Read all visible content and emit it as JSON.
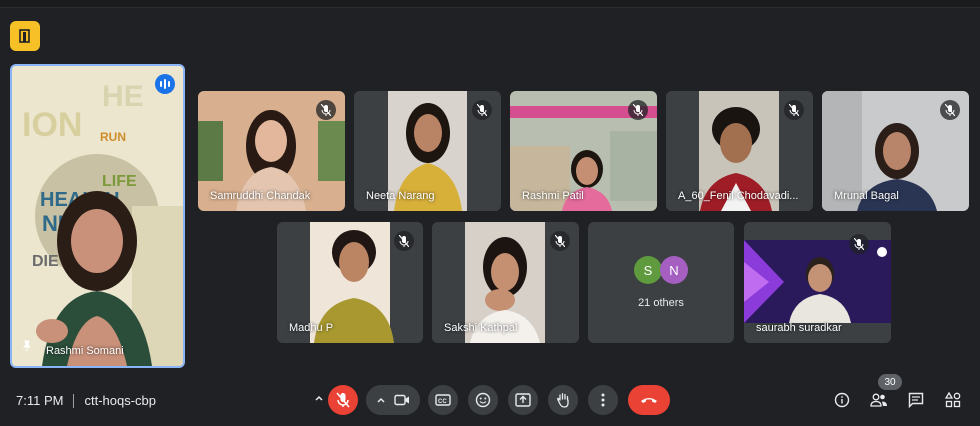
{
  "meeting": {
    "time": "7:11 PM",
    "code": "ctt-hoqs-cbp",
    "participant_count": "30"
  },
  "main_tile": {
    "name": "Rashmi Somani"
  },
  "tiles": [
    {
      "name": "Samruddhi Chandak"
    },
    {
      "name": "Neeta Narang"
    },
    {
      "name": "Rashmi Patil"
    },
    {
      "name": "A_60_Fenil Chodavadi..."
    },
    {
      "name": "Mrunal Bagal"
    },
    {
      "name": "Madhu P"
    },
    {
      "name": "Sakshi Kathpal"
    },
    {
      "name": "saurabh suradkar"
    }
  ],
  "others_tile": {
    "avatars": [
      {
        "letter": "S",
        "color": "#5f9b3e"
      },
      {
        "letter": "N",
        "color": "#a55fc1"
      }
    ],
    "label": "21 others"
  },
  "controls": {
    "mic": "mic-off-icon",
    "camera": "camera-icon",
    "captions": "captions-icon",
    "reactions": "emoji-icon",
    "present": "present-icon",
    "raise_hand": "hand-icon",
    "more": "more-icon",
    "leave": "end-call-icon"
  },
  "colors": {
    "background": "#202124",
    "tile": "#3c4043",
    "accent": "#8ab4f8",
    "danger": "#ea4335",
    "app_icon": "#f6c026"
  }
}
